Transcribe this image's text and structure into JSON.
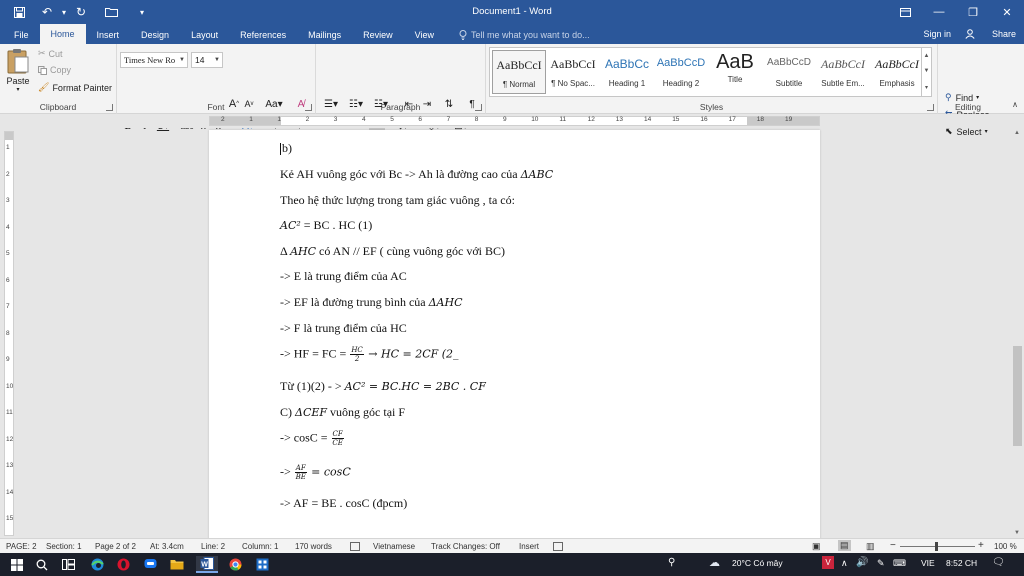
{
  "window": {
    "title": "Document1 - Word"
  },
  "tabs": [
    {
      "label": "File"
    },
    {
      "label": "Home"
    },
    {
      "label": "Insert"
    },
    {
      "label": "Design"
    },
    {
      "label": "Layout"
    },
    {
      "label": "References"
    },
    {
      "label": "Mailings"
    },
    {
      "label": "Review"
    },
    {
      "label": "View"
    }
  ],
  "tell_me": {
    "placeholder": "Tell me what you want to do..."
  },
  "account": {
    "sign_in": "Sign in",
    "share": "Share"
  },
  "clipboard": {
    "paste": "Paste",
    "cut": "Cut",
    "copy": "Copy",
    "format_painter": "Format Painter",
    "label": "Clipboard"
  },
  "font": {
    "name": "Times New Ro",
    "size": "14",
    "label": "Font"
  },
  "paragraph": {
    "label": "Paragraph"
  },
  "styles": {
    "label": "Styles",
    "items": [
      {
        "sample": "AaBbCcI",
        "name": "¶ Normal"
      },
      {
        "sample": "AaBbCcI",
        "name": "¶ No Spac..."
      },
      {
        "sample": "AaBbCc",
        "name": "Heading 1"
      },
      {
        "sample": "AaBbCcD",
        "name": "Heading 2"
      },
      {
        "sample": "AaB",
        "name": "Title"
      },
      {
        "sample": "AaBbCcD",
        "name": "Subtitle"
      },
      {
        "sample": "AaBbCcI",
        "name": "Subtle Em..."
      },
      {
        "sample": "AaBbCcI",
        "name": "Emphasis"
      }
    ]
  },
  "editing": {
    "find": "Find",
    "replace": "Replace",
    "select": "Select",
    "label": "Editing"
  },
  "ruler": {
    "h_numbers": [
      "2",
      "1",
      "1",
      "2",
      "3",
      "4",
      "5",
      "6",
      "7",
      "8",
      "9",
      "10",
      "11",
      "12",
      "13",
      "14",
      "15",
      "16",
      "17",
      "18",
      "19"
    ],
    "v_numbers": [
      "1",
      "2",
      "3",
      "4",
      "5",
      "6",
      "7",
      "8",
      "9",
      "10",
      "11",
      "12",
      "13",
      "14",
      "15"
    ]
  },
  "document": {
    "l1": "b)",
    "l2a": "Kẻ AH vuông góc với Bc -> Ah là đường cao của ",
    "l2m": "ΔABC",
    "l3": "Theo hệ thức lượng trong tam giác vuông , ta có:",
    "l4m": "AC²",
    "l4b": " = BC . HC (1)",
    "l5a": "Δ ",
    "l5m": "AHC",
    "l5b": " có AN // EF ( cùng vuông góc với BC)",
    "l6": "-> E là trung điểm của AC",
    "l7a": "-> EF là đường trung bình của ",
    "l7m": "ΔAHC",
    "l8": "-> F là trung điểm của HC",
    "l9a": "-> HF = FC = ",
    "l9num": "HC",
    "l9den": "2",
    "l9m": " → HC = 2CF (2_",
    "l10a": "Từ (1)(2) - > ",
    "l10m": "AC² = BC.HC = 2BC . CF",
    "l11a": "C) ",
    "l11m": "ΔCEF",
    "l11b": " vuông góc tại F",
    "l12a": "-> cosC = ",
    "l12num": "CF",
    "l12den": "CE",
    "l13a": "-> ",
    "l13num": "AF",
    "l13den": "BE",
    "l13m": " = cosC",
    "l14": "-> AF = BE . cosC (đpcm)"
  },
  "status": {
    "page": "PAGE: 2",
    "section": "Section: 1",
    "page_of": "Page 2 of 2",
    "at": "At: 3.4cm",
    "line": "Line: 2",
    "column": "Column: 1",
    "words": "170 words",
    "language": "Vietnamese",
    "track": "Track Changes: Off",
    "insert": "Insert",
    "zoom": "100 %"
  },
  "taskbar": {
    "weather": "20°C  Có mây",
    "lang": "VIE",
    "time": "8:52 CH"
  },
  "colors": {
    "word_blue": "#2b579a",
    "ribbon_bg": "#f3f3f3",
    "taskbar_bg": "#1b1f2a"
  }
}
